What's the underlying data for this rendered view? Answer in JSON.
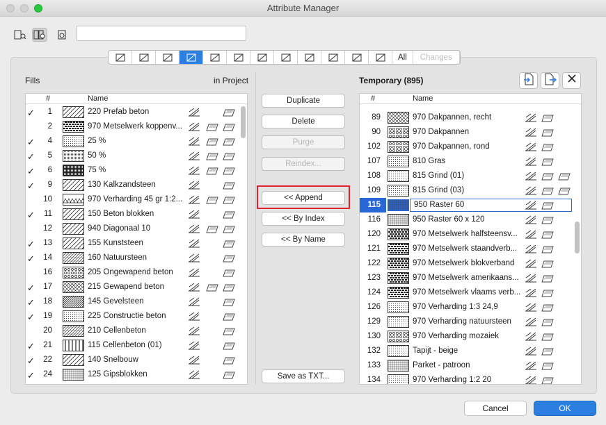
{
  "window": {
    "title": "Attribute Manager"
  },
  "toolbar": {
    "icons": [
      "file-search-icon",
      "double-file-search-icon",
      "file-search-right-icon"
    ]
  },
  "tabs": {
    "icons": [
      "layers-icon",
      "pen-icon",
      "line-type-icon",
      "fill-icon",
      "composite-icon",
      "building-material-icon",
      "profile-icon",
      "column-profile-icon",
      "zone-icon",
      "globe-icon",
      "link-icon",
      "grid-table-icon"
    ],
    "all": "All",
    "changes": "Changes"
  },
  "left": {
    "title": "Fills",
    "subtitle": "in Project",
    "col_num": "#",
    "col_name": "Name",
    "rows": [
      {
        "check": "✓",
        "num": "1",
        "name": "220 Prefab beton"
      },
      {
        "check": "",
        "num": "2",
        "name": "970 Metselwerk koppenv..."
      },
      {
        "check": "✓",
        "num": "4",
        "name": "25 %"
      },
      {
        "check": "✓",
        "num": "5",
        "name": "50 %"
      },
      {
        "check": "✓",
        "num": "6",
        "name": "75 %"
      },
      {
        "check": "✓",
        "num": "9",
        "name": "130 Kalkzandsteen"
      },
      {
        "check": "",
        "num": "10",
        "name": "970 Verharding 45 gr 1:2..."
      },
      {
        "check": "✓",
        "num": "11",
        "name": "150 Beton blokken"
      },
      {
        "check": "",
        "num": "12",
        "name": "940 Diagonaal 10"
      },
      {
        "check": "✓",
        "num": "13",
        "name": "155 Kunststeen"
      },
      {
        "check": "✓",
        "num": "14",
        "name": "160 Natuursteen"
      },
      {
        "check": "",
        "num": "16",
        "name": "205 Ongewapend beton"
      },
      {
        "check": "✓",
        "num": "17",
        "name": "215 Gewapend beton"
      },
      {
        "check": "✓",
        "num": "18",
        "name": "145 Gevelsteen"
      },
      {
        "check": "✓",
        "num": "19",
        "name": "225 Constructie beton"
      },
      {
        "check": "",
        "num": "20",
        "name": "210 Cellenbeton"
      },
      {
        "check": "✓",
        "num": "21",
        "name": "115 Cellenbeton (01)"
      },
      {
        "check": "✓",
        "num": "22",
        "name": "140 Snelbouw"
      },
      {
        "check": "✓",
        "num": "24",
        "name": "125 Gipsblokken"
      }
    ]
  },
  "middle": {
    "duplicate": "Duplicate",
    "delete": "Delete",
    "purge": "Purge",
    "reindex": "Reindex...",
    "append": "<< Append",
    "by_index": "<< By Index",
    "by_name": "<< By Name",
    "save_txt": "Save as TXT..."
  },
  "right": {
    "title": "Temporary (895)",
    "col_num": "#",
    "col_name": "Name",
    "rows": [
      {
        "num": "89",
        "name": "970 Dakpannen, recht"
      },
      {
        "num": "90",
        "name": "970 Dakpannen"
      },
      {
        "num": "102",
        "name": "970 Dakpannen, rond"
      },
      {
        "num": "107",
        "name": "810 Gras"
      },
      {
        "num": "108",
        "name": "815 Grind (01)"
      },
      {
        "num": "109",
        "name": "815 Grind (03)"
      },
      {
        "num": "115",
        "name": "950 Raster 60"
      },
      {
        "num": "116",
        "name": "950 Raster 60 x 120"
      },
      {
        "num": "120",
        "name": "970 Metselwerk halfsteensv..."
      },
      {
        "num": "121",
        "name": "970 Metselwerk staandverb..."
      },
      {
        "num": "122",
        "name": "970 Metselwerk blokverband"
      },
      {
        "num": "123",
        "name": "970 Metselwerk amerikaans..."
      },
      {
        "num": "124",
        "name": "970 Metselwerk vlaams verb..."
      },
      {
        "num": "126",
        "name": "970 Verharding 1:3  24,9"
      },
      {
        "num": "129",
        "name": "970 Verharding natuursteen"
      },
      {
        "num": "130",
        "name": "970 Verharding mozaiek"
      },
      {
        "num": "132",
        "name": "Tapijt - beige"
      },
      {
        "num": "133",
        "name": "Parket - patroon"
      },
      {
        "num": "134",
        "name": "970 Verharding 1:2  20"
      }
    ]
  },
  "footer": {
    "cancel": "Cancel",
    "ok": "OK"
  }
}
